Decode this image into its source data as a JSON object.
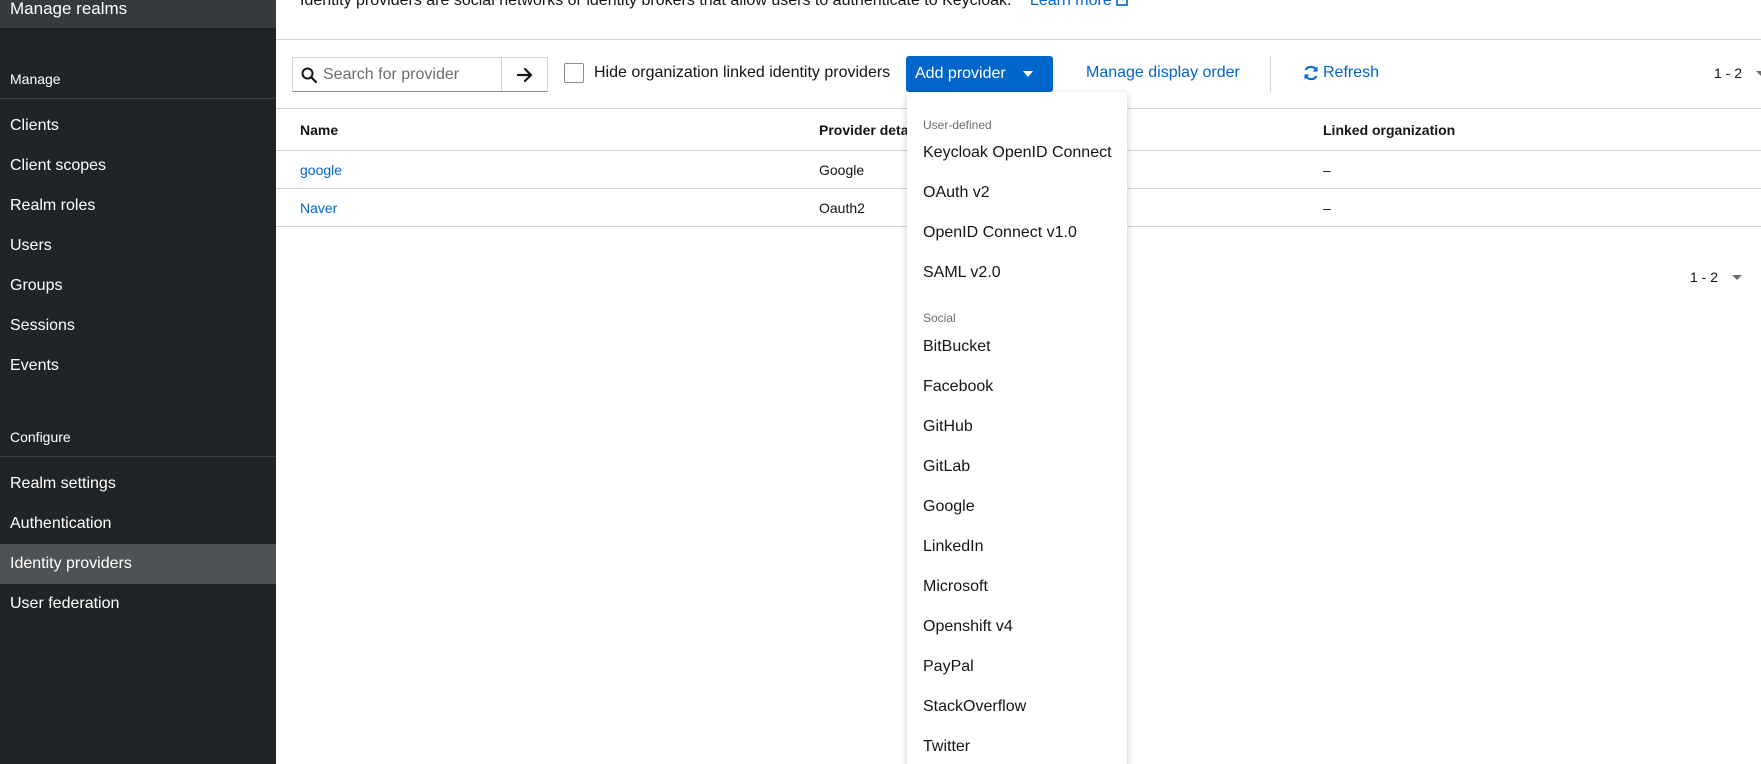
{
  "sidebar": {
    "top_item": "Manage realms",
    "sections": {
      "manage": "Manage",
      "configure": "Configure"
    },
    "manage_items": [
      "Clients",
      "Client scopes",
      "Realm roles",
      "Users",
      "Groups",
      "Sessions",
      "Events"
    ],
    "configure_items": [
      "Realm settings",
      "Authentication",
      "Identity providers",
      "User federation"
    ],
    "active_item": "Identity providers"
  },
  "header": {
    "description": "Identity providers are social networks or identity brokers that allow users to authenticate to Keycloak.",
    "learn_more": "Learn more"
  },
  "toolbar": {
    "search_placeholder": "Search for provider",
    "hide_org_label": "Hide organization linked identity providers",
    "add_provider_label": "Add provider",
    "manage_order_label": "Manage display order",
    "refresh_label": "Refresh",
    "pagination": "1 - 2"
  },
  "table": {
    "columns": [
      "Name",
      "Provider details",
      "Linked organization"
    ],
    "visible_column_headers": [
      "Name",
      "Provider deta",
      "Linked organization"
    ],
    "rows": [
      {
        "name": "google",
        "provider": "Google",
        "org": "–"
      },
      {
        "name": "Naver",
        "provider": "Oauth2",
        "org": "–"
      }
    ],
    "pagination": "1 - 2"
  },
  "menu": {
    "groups": [
      {
        "label": "User-defined",
        "items": [
          "Keycloak OpenID Connect",
          "OAuth v2",
          "OpenID Connect v1.0",
          "SAML v2.0"
        ]
      },
      {
        "label": "Social",
        "items": [
          "BitBucket",
          "Facebook",
          "GitHub",
          "GitLab",
          "Google",
          "LinkedIn",
          "Microsoft",
          "Openshift v4",
          "PayPal",
          "StackOverflow",
          "Twitter"
        ]
      }
    ]
  },
  "colors": {
    "sidebar_bg": "#212427",
    "sidebar_active": "#4f5255",
    "accent": "#0066cc"
  }
}
